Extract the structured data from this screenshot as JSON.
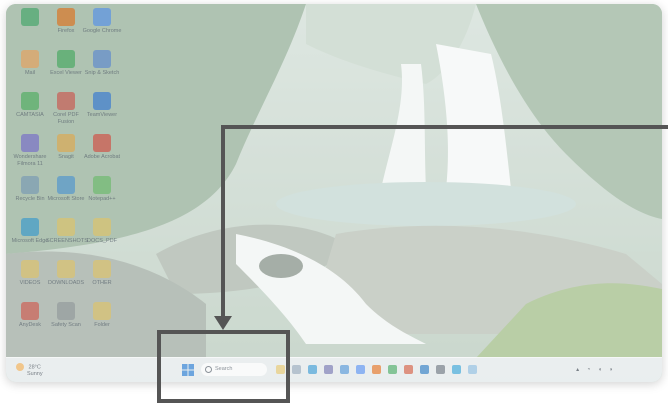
{
  "desktop": {
    "icons": [
      {
        "label": "",
        "color": "#2b9e5a",
        "col": 0,
        "row": 0
      },
      {
        "label": "Firefox",
        "color": "#e66000",
        "col": 1,
        "row": 0
      },
      {
        "label": "Google Chrome",
        "color": "#4285f4",
        "col": 2,
        "row": 0
      },
      {
        "label": "Mail",
        "color": "#f2994a",
        "col": 0,
        "row": 1
      },
      {
        "label": "Excel Viewer",
        "color": "#2fa34f",
        "col": 1,
        "row": 1
      },
      {
        "label": "Snip & Sketch",
        "color": "#4b7bd6",
        "col": 2,
        "row": 1
      },
      {
        "label": "CAMTASIA",
        "color": "#3aa84f",
        "col": 0,
        "row": 2
      },
      {
        "label": "Corel PDF Fusion",
        "color": "#d0403a",
        "col": 1,
        "row": 2
      },
      {
        "label": "TeamViewer",
        "color": "#1b68d8",
        "col": 2,
        "row": 2
      },
      {
        "label": "Wondershare Filmora 11",
        "color": "#6a5acd",
        "col": 0,
        "row": 3
      },
      {
        "label": "Snagit",
        "color": "#e8a23a",
        "col": 1,
        "row": 3
      },
      {
        "label": "Adobe Acrobat",
        "color": "#d8342c",
        "col": 2,
        "row": 3
      },
      {
        "label": "Recycle Bin",
        "color": "#6b8fb5",
        "col": 0,
        "row": 4
      },
      {
        "label": "Microsoft Store",
        "color": "#3a8ad6",
        "col": 1,
        "row": 4
      },
      {
        "label": "Notepad++",
        "color": "#5cb85c",
        "col": 2,
        "row": 4
      },
      {
        "label": "Microsoft Edge",
        "color": "#1f8fd1",
        "col": 0,
        "row": 5
      },
      {
        "label": "SCREENSHOTS",
        "color": "#e8c35a",
        "col": 1,
        "row": 5
      },
      {
        "label": "DOCS_PDF",
        "color": "#e8c35a",
        "col": 2,
        "row": 5
      },
      {
        "label": "VIDEOS",
        "color": "#e8c35a",
        "col": 0,
        "row": 6
      },
      {
        "label": "DOWNLOADS",
        "color": "#e8c35a",
        "col": 1,
        "row": 6
      },
      {
        "label": "OTHER",
        "color": "#e8c35a",
        "col": 2,
        "row": 6
      },
      {
        "label": "AnyDesk",
        "color": "#d6453a",
        "col": 0,
        "row": 7
      },
      {
        "label": "Safety Scan",
        "color": "#8a8f95",
        "col": 1,
        "row": 7
      },
      {
        "label": "Folder",
        "color": "#e8c35a",
        "col": 2,
        "row": 7
      }
    ]
  },
  "taskbar": {
    "weather_temp": "28°C",
    "weather_desc": "Sunny",
    "search_placeholder": "Search",
    "apps": [
      {
        "name": "file-explorer",
        "color": "#e8c35a"
      },
      {
        "name": "widgets",
        "color": "#8aa1b5"
      },
      {
        "name": "edge",
        "color": "#1f8fd1"
      },
      {
        "name": "teams",
        "color": "#6264a7"
      },
      {
        "name": "store",
        "color": "#3a8ad6"
      },
      {
        "name": "chrome",
        "color": "#4285f4"
      },
      {
        "name": "firefox",
        "color": "#e66000"
      },
      {
        "name": "excel",
        "color": "#2fa34f"
      },
      {
        "name": "powerpoint",
        "color": "#d24726"
      },
      {
        "name": "outlook",
        "color": "#0f6cbd"
      },
      {
        "name": "camera",
        "color": "#5a6470"
      },
      {
        "name": "photos",
        "color": "#1b9ad6"
      },
      {
        "name": "notepad",
        "color": "#7fb8e0"
      }
    ],
    "tray_time": "",
    "tray_date": ""
  },
  "callout": {
    "border_color": "#555555"
  }
}
